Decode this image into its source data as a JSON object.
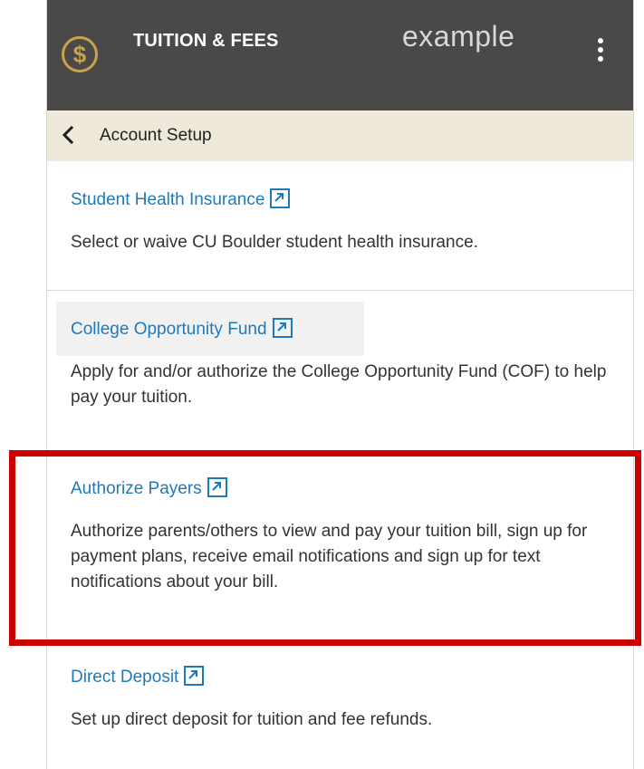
{
  "header": {
    "title": "TUITION & FEES",
    "watermark": "example",
    "logo_glyph": "$",
    "logo_color": "#c9a24d",
    "background_color": "#4a4947",
    "menu_icon": "kebab-menu-icon"
  },
  "subheader": {
    "back_icon": "chevron-left-icon",
    "title": "Account Setup",
    "background_color": "#efe9dc"
  },
  "items": [
    {
      "link": "Student Health Insurance",
      "icon": "external-link-icon",
      "description": "Select or waive CU Boulder student health insurance."
    },
    {
      "link": "College Opportunity Fund",
      "icon": "external-link-icon",
      "description": "Apply for and/or authorize the College Opportunity Fund (COF) to help pay your tuition."
    },
    {
      "link": "Authorize Payers",
      "icon": "external-link-icon",
      "description": "Authorize parents/others to view and pay your tuition bill, sign up for payment plans, receive email notifications and sign up for text notifications about your bill.",
      "highlighted": true
    },
    {
      "link": "Direct Deposit",
      "icon": "external-link-icon",
      "description": "Set up direct deposit for tuition and fee refunds."
    }
  ],
  "colors": {
    "link": "#1f7ab8",
    "highlight_box": "#cc0000"
  }
}
